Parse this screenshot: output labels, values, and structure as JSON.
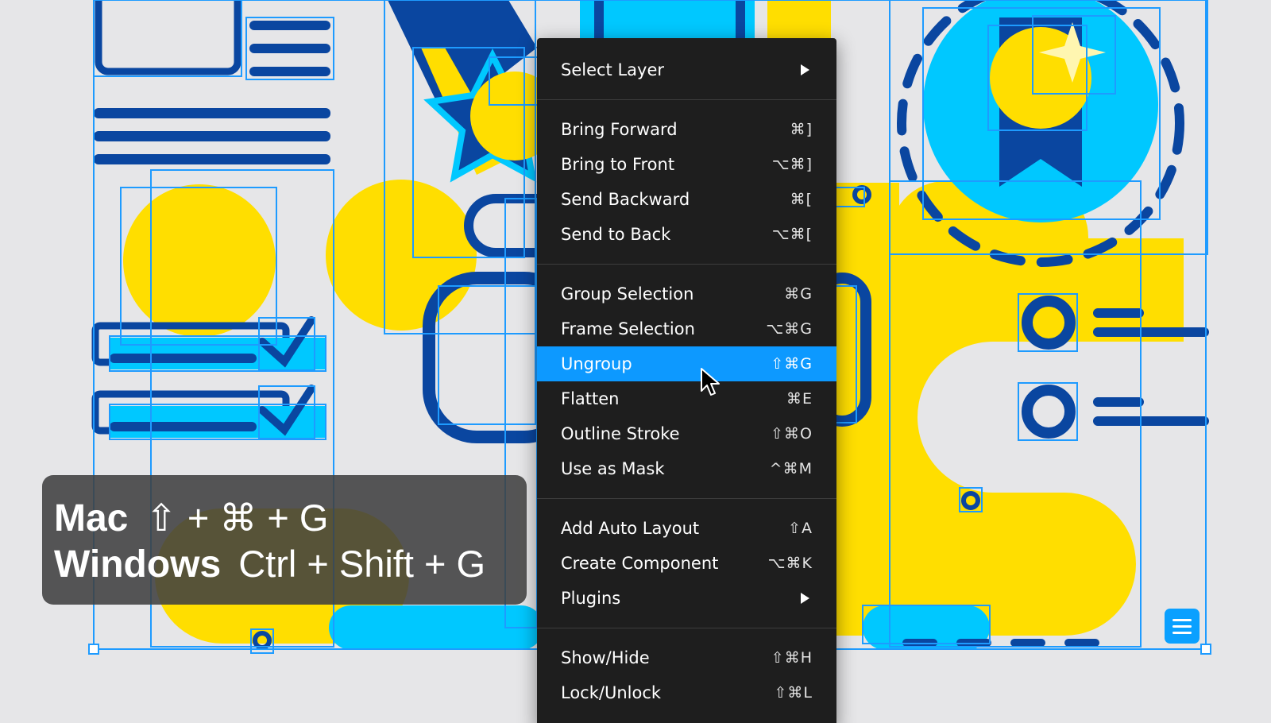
{
  "menu": {
    "groups": [
      [
        {
          "label": "Select Layer",
          "shortcut": "",
          "submenu": true
        }
      ],
      [
        {
          "label": "Bring Forward",
          "shortcut": "⌘]"
        },
        {
          "label": "Bring to Front",
          "shortcut": "⌥⌘]"
        },
        {
          "label": "Send Backward",
          "shortcut": "⌘["
        },
        {
          "label": "Send to Back",
          "shortcut": "⌥⌘["
        }
      ],
      [
        {
          "label": "Group Selection",
          "shortcut": "⌘G"
        },
        {
          "label": "Frame Selection",
          "shortcut": "⌥⌘G"
        },
        {
          "label": "Ungroup",
          "shortcut": "⇧⌘G",
          "highlighted": true
        },
        {
          "label": "Flatten",
          "shortcut": "⌘E"
        },
        {
          "label": "Outline Stroke",
          "shortcut": "⇧⌘O"
        },
        {
          "label": "Use as Mask",
          "shortcut": "^⌘M"
        }
      ],
      [
        {
          "label": "Add Auto Layout",
          "shortcut": "⇧A"
        },
        {
          "label": "Create Component",
          "shortcut": "⌥⌘K"
        },
        {
          "label": "Plugins",
          "shortcut": "",
          "submenu": true
        }
      ],
      [
        {
          "label": "Show/Hide",
          "shortcut": "⇧⌘H"
        },
        {
          "label": "Lock/Unlock",
          "shortcut": "⇧⌘L"
        }
      ]
    ]
  },
  "shortcut_panel": {
    "mac_label": "Mac",
    "mac_keys": "⇧ + ⌘ + G",
    "windows_label": "Windows",
    "windows_keys": "Ctrl + Shift + G"
  },
  "colors": {
    "yellow": "#ffde00",
    "cyan": "#00c8ff",
    "navy": "#0a46a0",
    "selection_blue": "#1e9bff",
    "menu_bg": "#1e1e1e",
    "highlight": "#0d99ff"
  }
}
